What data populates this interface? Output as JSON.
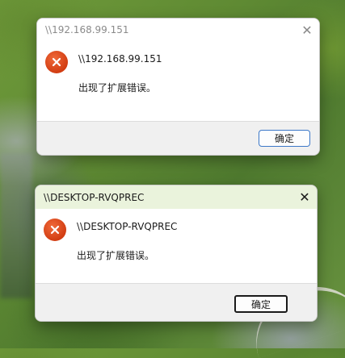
{
  "colors": {
    "error_icon": "#e04a1a",
    "focused_title_bar": "#eaf3dc",
    "button_border": "#3c78c8"
  },
  "dialogs": [
    {
      "window_title": "\\\\192.168.99.151",
      "icon": "error-icon",
      "message_title": "\\\\192.168.99.151",
      "message_text": "出现了扩展错误。",
      "ok_label": "确定",
      "close_icon": "close-icon"
    },
    {
      "window_title": "\\\\DESKTOP-RVQPREC",
      "icon": "error-icon",
      "message_title": "\\\\DESKTOP-RVQPREC",
      "message_text": "出现了扩展错误。",
      "ok_label": "确定",
      "close_icon": "close-icon"
    }
  ]
}
